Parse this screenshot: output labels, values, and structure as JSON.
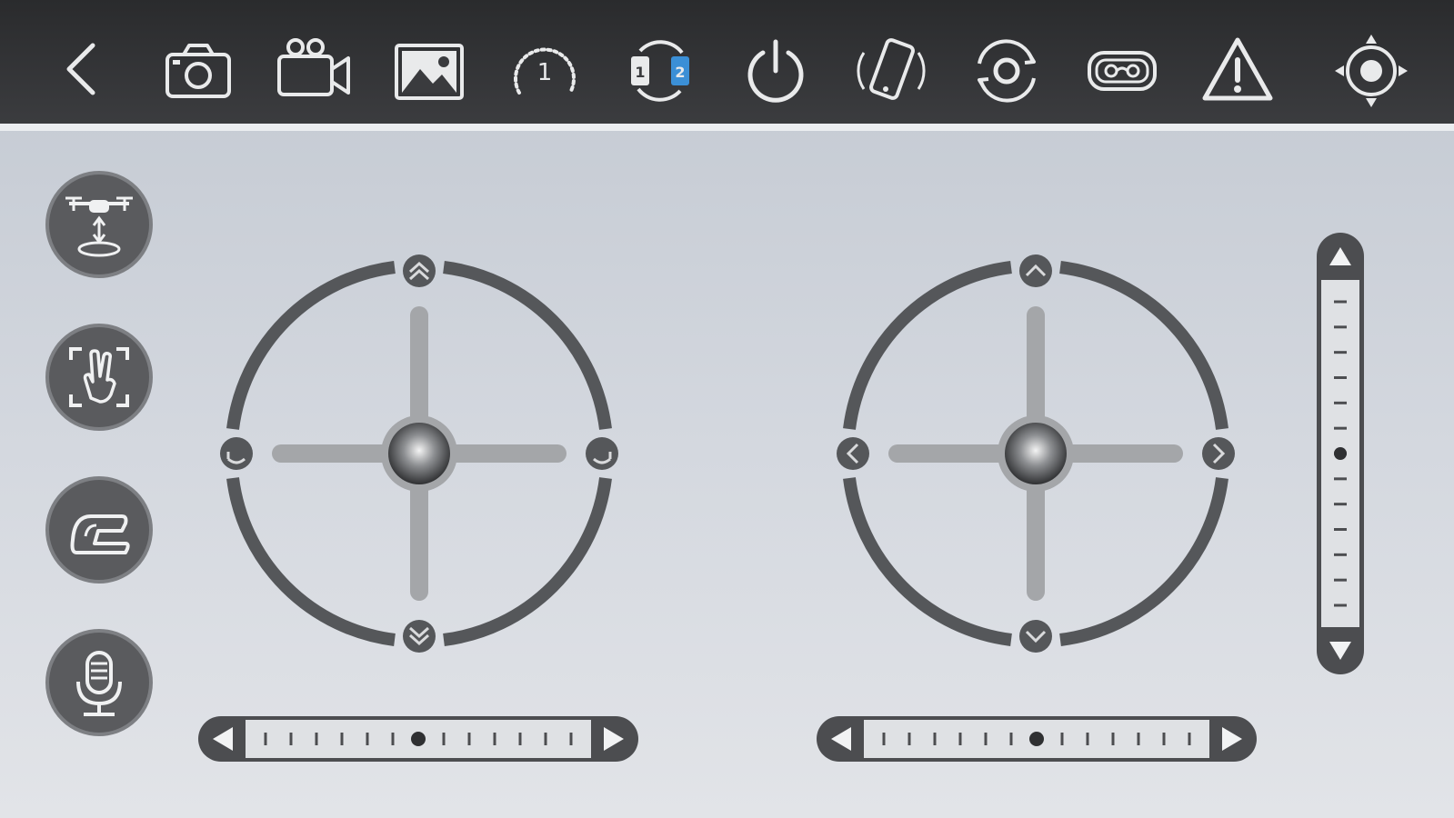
{
  "toolbar": {
    "buttons": [
      {
        "name": "back",
        "icon": "chevron-left-icon"
      },
      {
        "name": "photo",
        "icon": "camera-icon"
      },
      {
        "name": "video",
        "icon": "video-camera-icon"
      },
      {
        "name": "gallery",
        "icon": "image-icon"
      },
      {
        "name": "speed",
        "icon": "speed-gauge-icon",
        "label": "1"
      },
      {
        "name": "mode-switch",
        "icon": "mode-switch-icon",
        "left_label": "1",
        "right_label": "2"
      },
      {
        "name": "power",
        "icon": "power-icon"
      },
      {
        "name": "gravity-sensor",
        "icon": "phone-rotate-icon"
      },
      {
        "name": "rotate-360",
        "icon": "rotate-360-icon"
      },
      {
        "name": "vr",
        "icon": "vr-goggles-icon"
      },
      {
        "name": "emergency-stop",
        "icon": "warning-icon"
      },
      {
        "name": "calibrate",
        "icon": "calibrate-crosshair-icon"
      }
    ],
    "accent_color": "#3b8fd6"
  },
  "side_buttons": [
    {
      "name": "takeoff-landing",
      "icon": "drone-takeoff-icon"
    },
    {
      "name": "gesture",
      "icon": "gesture-hand-icon"
    },
    {
      "name": "trajectory",
      "icon": "trajectory-path-icon"
    },
    {
      "name": "voice",
      "icon": "microphone-icon"
    }
  ],
  "joysticks": {
    "left": {
      "up": "up-double-chevron-icon",
      "down": "down-double-chevron-icon",
      "left": "rotate-left-icon",
      "right": "rotate-right-icon"
    },
    "right": {
      "up": "chevron-up-icon",
      "down": "chevron-down-icon",
      "left": "chevron-left-icon",
      "right": "chevron-right-icon"
    }
  },
  "trims": {
    "left_horizontal": {
      "ticks": 13,
      "value": 0.5
    },
    "right_horizontal": {
      "ticks": 13,
      "value": 0.5
    },
    "vertical": {
      "ticks": 13,
      "value": 0.5
    }
  },
  "colors": {
    "topbar": "#333436",
    "ring": "#55575a",
    "cross": "#a4a6a9",
    "button": "#5a5b5e"
  }
}
